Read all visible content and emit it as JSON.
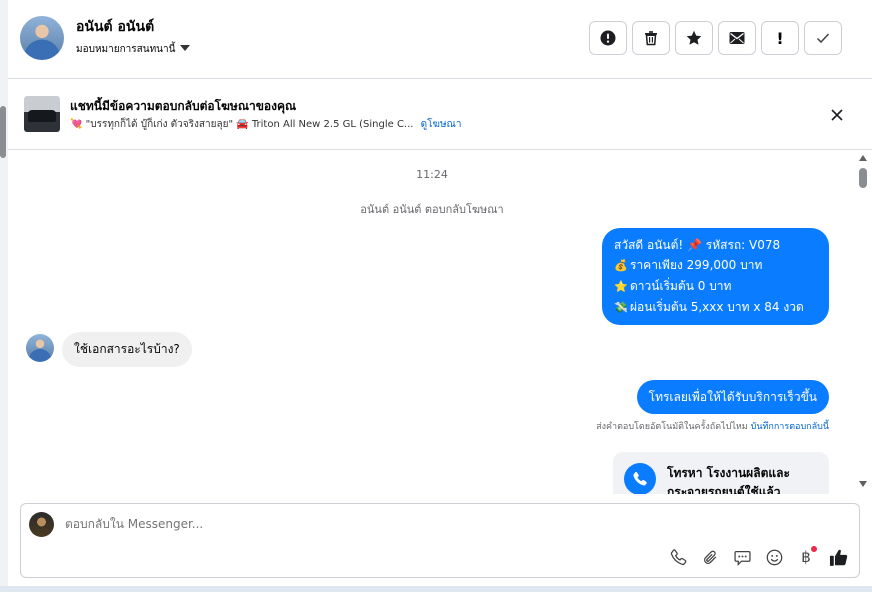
{
  "header": {
    "name": "อนันต์ อนันต์",
    "assign_label": "มอบหมายการสนทนานี้",
    "buttons": [
      {
        "name": "spam-button",
        "icon": "alert-circle-icon"
      },
      {
        "name": "delete-button",
        "icon": "trash-icon"
      },
      {
        "name": "star-button",
        "icon": "star-icon"
      },
      {
        "name": "mail-button",
        "icon": "envelope-icon"
      },
      {
        "name": "important-button",
        "icon": "exclamation-icon",
        "glyph": "!"
      },
      {
        "name": "done-button",
        "icon": "checkmark-icon"
      }
    ]
  },
  "ad_banner": {
    "title": "แชทนี้มีข้อความตอบกลับต่อโฆษณาของคุณ",
    "subtitle": "\"บรรทุกก็ได้ บู๊ก็เก่ง ตัวจริงสายลุย\"",
    "product": "Triton All New 2.5 GL (Single C...",
    "link": "ดูโฆษณา"
  },
  "conversation": {
    "timestamp": "11:24",
    "replied_note": "อนันต์ อนันต์ ตอบกลับโฆษณา",
    "outgoing_1": [
      {
        "icon": "📌",
        "text": "สวัสดี อนันต์! 📌 รหัสรถ: V078"
      },
      {
        "icon": "💰",
        "text": "ราคาเพียง 299,000 บาท"
      },
      {
        "icon": "⭐",
        "text": "ดาวน์เริ่มต้น 0 บาท"
      },
      {
        "icon": "💸",
        "text": "ผ่อนเริ่มต้น 5,xxx บาท x 84 งวด"
      }
    ],
    "incoming_1": "ใช้เอกสารอะไรบ้าง?",
    "outgoing_2": "โทรเลยเพื่อให้ได้รับบริการเร็วขึ้น",
    "auto_reply_note": "ส่งคำตอบโดยอัตโนมัติในครั้งถัดไปไหม",
    "auto_reply_link": "บันทึกการตอบกลับนี้",
    "call_card_text": "โทรหา โรงงานผลิตและกระจายรถยนต์ใช้แล้ว"
  },
  "composer": {
    "placeholder": "ตอบกลับใน Messenger...",
    "tools": [
      "phone-icon",
      "attachment-icon",
      "chat-icon",
      "emoji-icon",
      "baht-icon",
      "thumbs-up-icon"
    ]
  },
  "colors": {
    "accent": "#0a7cff",
    "link": "#0064d1",
    "notification_dot": "#f02849"
  }
}
